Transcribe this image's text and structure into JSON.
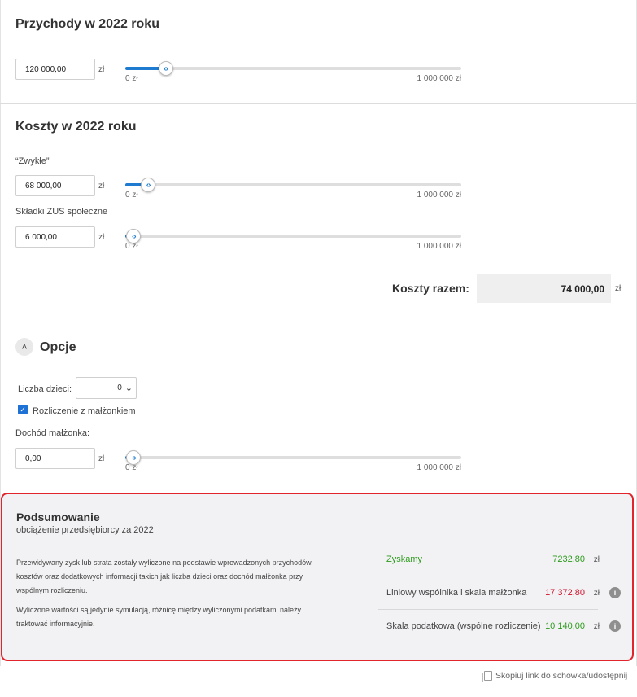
{
  "revenue": {
    "title": "Przychody w 2022 roku",
    "value": "120 000,00",
    "unit": "zł",
    "slider": {
      "fraction": 0.12,
      "min_label": "0 zł",
      "max_label": "1 000 000 zł"
    }
  },
  "costs": {
    "title": "Koszty w 2022 roku",
    "regular": {
      "label": "“Zwykłe”",
      "value": "68 000,00",
      "unit": "zł",
      "slider": {
        "fraction": 0.068,
        "min_label": "0 zł",
        "max_label": "1 000 000 zł"
      }
    },
    "zus": {
      "label": "Składki ZUS społeczne",
      "value": "6 000,00",
      "unit": "zł",
      "slider": {
        "fraction": 0.006,
        "min_label": "0 zł",
        "max_label": "1 000 000 zł"
      }
    },
    "total_label": "Koszty razem:",
    "total_value": "74 000,00",
    "total_unit": "zł"
  },
  "options": {
    "title": "Opcje",
    "toggle_icon": "chevron-up-icon",
    "children_label": "Liczba dzieci:",
    "children_value": "0",
    "spouse_checkbox_label": "Rozliczenie z małżonkiem",
    "spouse_checked": true,
    "spouse_income_label": "Dochód małżonka:",
    "spouse_income_value": "0,00",
    "spouse_income_unit": "zł",
    "slider": {
      "fraction": 0.0,
      "min_label": "0 zł",
      "max_label": "1 000 000 zł"
    }
  },
  "summary": {
    "title": "Podsumowanie",
    "subtitle": "obciążenie przedsiębiorcy za 2022",
    "paragraph1": "Przewidywany zysk lub strata zostały wyliczone na podstawie wprowadzonych przychodów, kosztów oraz dodatkowych informacji takich jak liczba dzieci oraz dochód małżonka przy wspólnym rozliczeniu.",
    "paragraph2": "Wyliczone wartości są jedynie symulacją, różnicę między wyliczonymi podatkami należy traktować informacyjnie.",
    "results": [
      {
        "label": "Zyskamy",
        "value": "7232,80",
        "unit": "zł",
        "color": "#2e9b1e",
        "label_color": "#2e9b1e",
        "info": false
      },
      {
        "label": "Liniowy wspólnika i skala małżonka",
        "value": "17 372,80",
        "unit": "zł",
        "color": "#d0102a",
        "label_color": "#444444",
        "info": true
      },
      {
        "label": "Skala podatkowa (wspólne rozliczenie)",
        "value": "10 140,00",
        "unit": "zł",
        "color": "#2e9b1e",
        "label_color": "#444444",
        "info": true
      }
    ],
    "info_glyph": "i",
    "border_color": "#e2242d"
  },
  "footer": {
    "copy_link_label": "Skopiuj link do schowka/udostępnij"
  },
  "colors": {
    "accent": "#1e7bd0",
    "positive": "#2e9b1e",
    "negative": "#d0102a"
  }
}
